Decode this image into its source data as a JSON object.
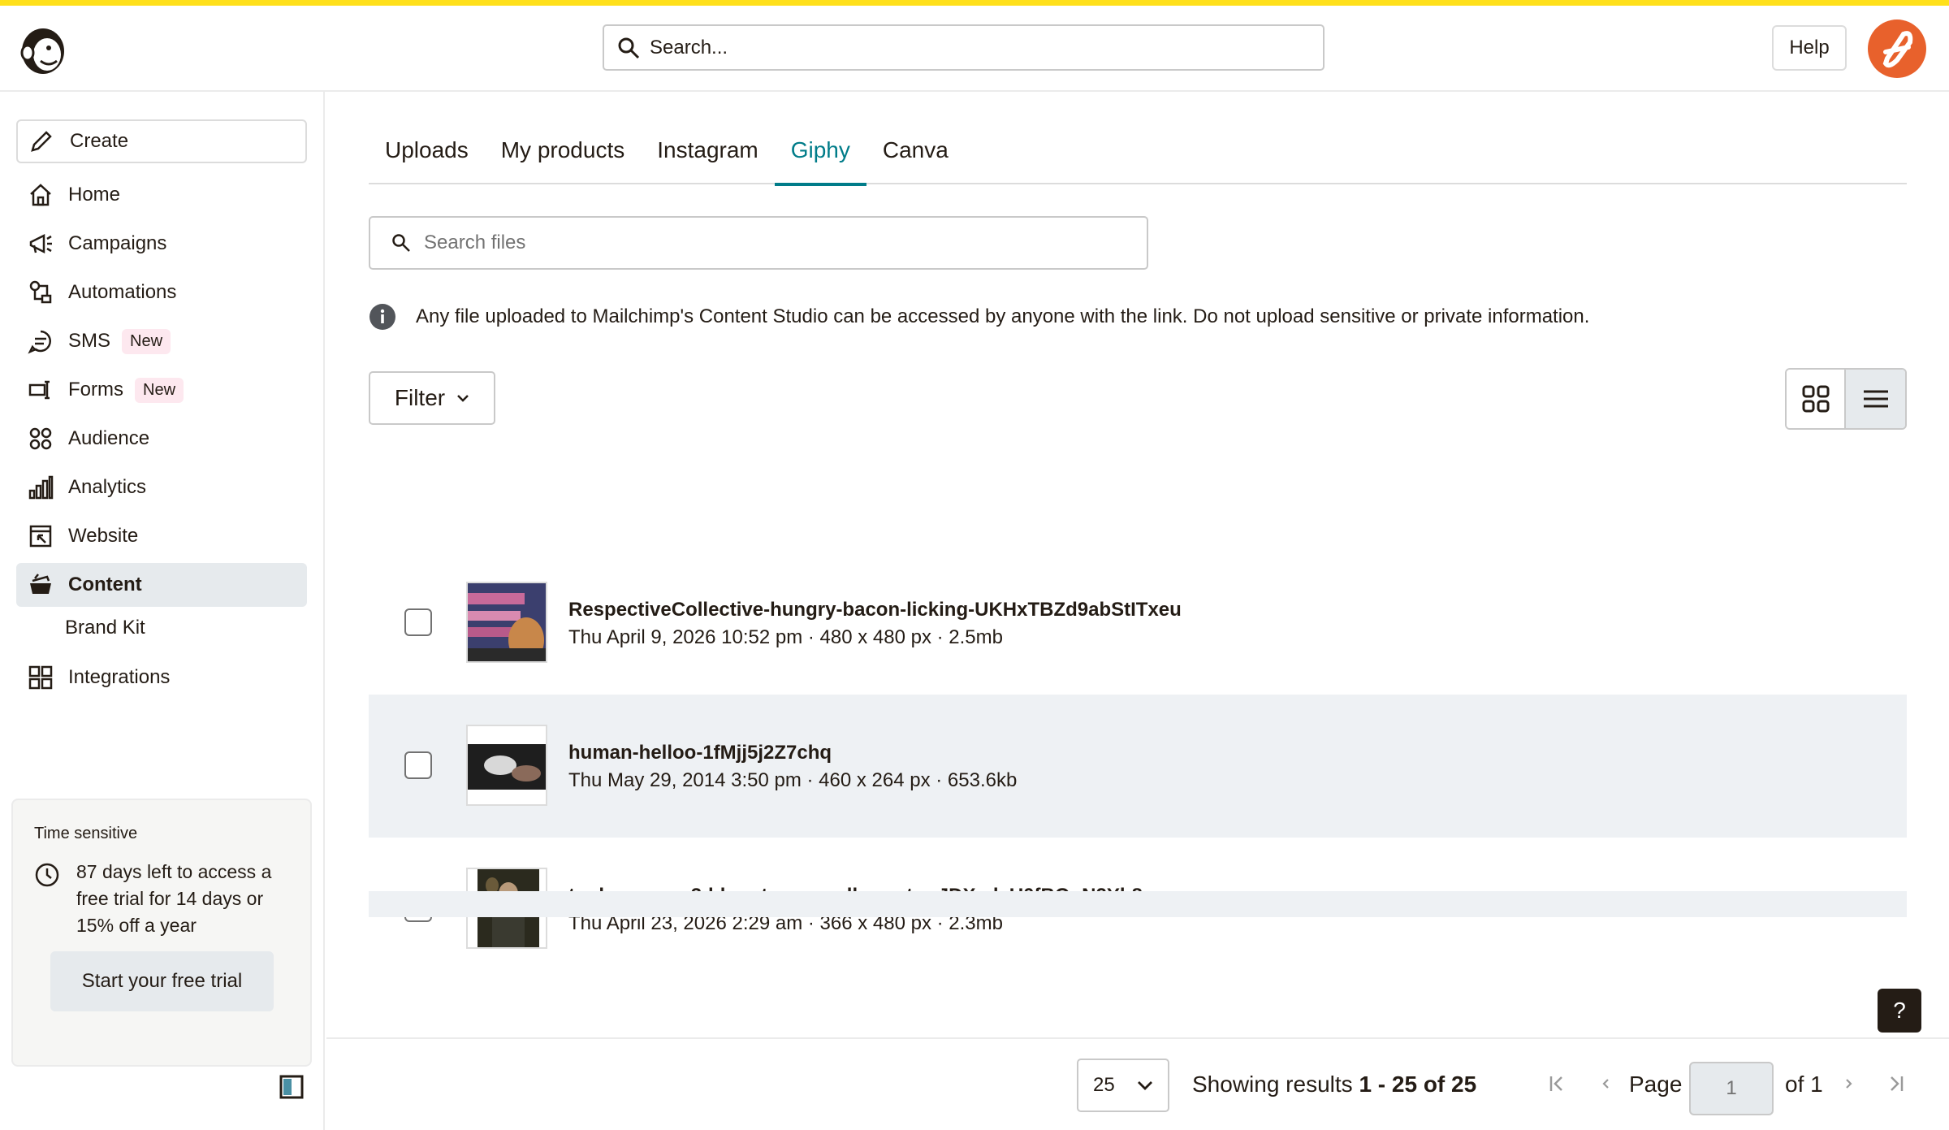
{
  "header": {
    "search_placeholder": "Search...",
    "help_label": "Help"
  },
  "sidebar": {
    "create_label": "Create",
    "items": [
      {
        "label": "Home",
        "icon": "home-icon"
      },
      {
        "label": "Campaigns",
        "icon": "megaphone-icon"
      },
      {
        "label": "Automations",
        "icon": "automations-icon"
      },
      {
        "label": "SMS",
        "icon": "sms-icon",
        "badge": "New"
      },
      {
        "label": "Forms",
        "icon": "forms-icon",
        "badge": "New"
      },
      {
        "label": "Audience",
        "icon": "audience-icon"
      },
      {
        "label": "Analytics",
        "icon": "analytics-icon"
      },
      {
        "label": "Website",
        "icon": "website-icon"
      },
      {
        "label": "Content",
        "icon": "content-icon",
        "active": true
      },
      {
        "label": "Brand Kit",
        "sub": true
      },
      {
        "label": "Integrations",
        "icon": "integrations-icon"
      }
    ],
    "trial": {
      "label": "Time sensitive",
      "text": "87 days left to access a free trial for 14 days or 15% off a year",
      "button": "Start your free trial"
    }
  },
  "tabs": [
    {
      "label": "Uploads"
    },
    {
      "label": "My products"
    },
    {
      "label": "Instagram"
    },
    {
      "label": "Giphy",
      "active": true
    },
    {
      "label": "Canva"
    }
  ],
  "file_search_placeholder": "Search files",
  "notice": "Any file uploaded to Mailchimp's Content Studio can be accessed by anyone with the link. Do not upload sensitive or private information.",
  "filter_label": "Filter",
  "files": [
    {
      "name": "RespectiveCollective-hungry-bacon-licking-UKHxTBZd9abStITxeu",
      "meta": "Thu April 9, 2026 10:52 pm · 480 x 480 px · 2.5mb"
    },
    {
      "name": "human-helloo-1fMjj5j2Z7chq",
      "meta": "Thu May 29, 2014 3:50 pm · 460 x 264 px · 653.6kb"
    },
    {
      "name": "tophermcgee3-hbo-steve-carell-rooster-JDXadsU0fBOnN2Yb8w",
      "meta": "Thu April 23, 2026 2:29 am · 366 x 480 px · 2.3mb"
    }
  ],
  "pager": {
    "per_page": "25",
    "showing_prefix": "Showing results ",
    "showing_range": "1 - 25 of 25",
    "page_label": "Page",
    "page_value": "1",
    "of_label": "of 1"
  },
  "help_q": "?",
  "colors": {
    "accent": "#007c89",
    "brand_yellow": "#ffe01b",
    "avatar": "#e8612c"
  }
}
